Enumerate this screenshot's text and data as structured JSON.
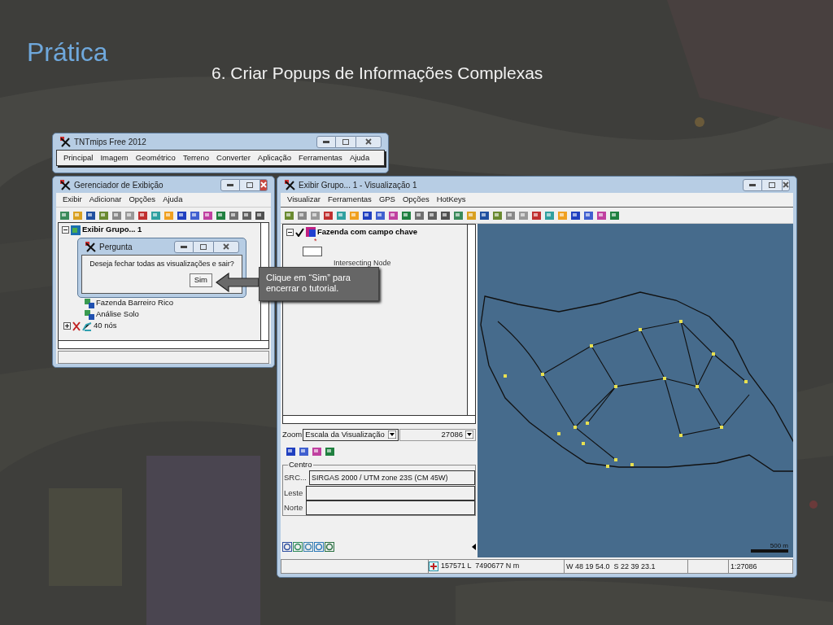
{
  "slide": {
    "title": "Prática",
    "subtitle": "6. Criar Popups de Informações Complexas"
  },
  "main_window": {
    "title": "TNTmips Free 2012",
    "menu": [
      "Principal",
      "Imagem",
      "Geométrico",
      "Terreno",
      "Converter",
      "Aplicação",
      "Ferramentas",
      "Ajuda"
    ]
  },
  "display_manager": {
    "title": "Gerenciador de Exibição",
    "menu": [
      "Exibir",
      "Adicionar",
      "Opções",
      "Ajuda"
    ],
    "tree": [
      {
        "label": "Exibir Grupo... 1",
        "expanded": true,
        "children": [
          {
            "label": "Fazenda Barreiro Rico"
          },
          {
            "label": "Análise Solo"
          },
          {
            "label": "40 nós",
            "expanded": false
          }
        ]
      }
    ]
  },
  "dialog": {
    "title": "Pergunta",
    "message": "Deseja fechar todas as visualizações e sair?",
    "buttons": [
      "Sim"
    ]
  },
  "callout": {
    "text": "Clique em “Sim” para encerrar o tutorial."
  },
  "view_window": {
    "title": "Exibir Grupo... 1 - Visualização 1",
    "menu": [
      "Visualizar",
      "Ferramentas",
      "GPS",
      "Opções",
      "HotKeys"
    ],
    "layer": {
      "label": "Fazenda com campo chave",
      "checked": true,
      "marker": "*",
      "legend_label": "Intersecting Node"
    },
    "zoom": {
      "label": "Zoom",
      "mode": "Escala da Visualização",
      "value": "27086"
    },
    "centro": {
      "label": "Centro",
      "src_button": "SRC...",
      "src_value": "SIRGAS 2000 / UTM zone 23S (CM 45W)",
      "fields": [
        "Leste",
        "Norte"
      ]
    },
    "scale_bar": "500 m",
    "status": {
      "coordinates": "157571 L  7490677 N m",
      "latlon": "W 48 19 54.0  S 22 39 23.1",
      "scale": "1:27086"
    }
  }
}
